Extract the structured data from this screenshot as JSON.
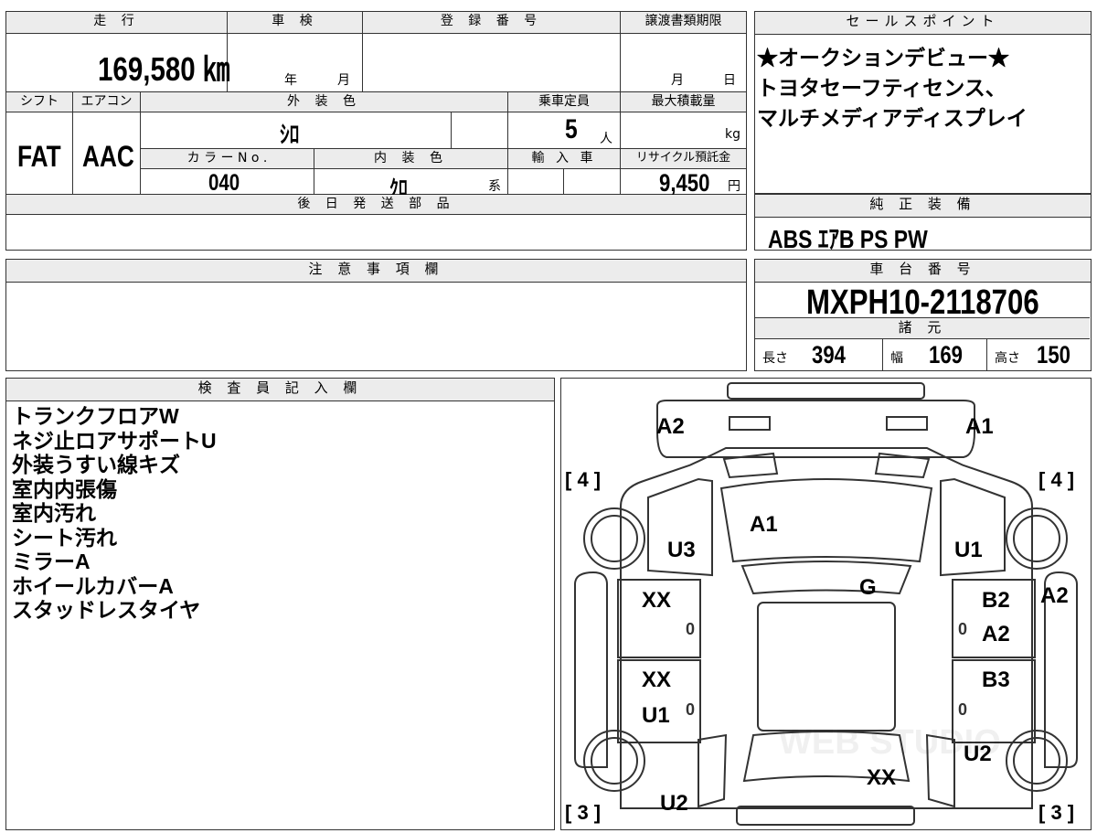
{
  "top_info": {
    "mileage_label": "走 行",
    "mileage_value": "169,580 ㎞",
    "inspection_label": "車 検",
    "inspection_year": "年",
    "inspection_month": "月",
    "registration_label": "登 録 番 号",
    "transfer_label": "譲渡書類期限",
    "transfer_month": "月",
    "transfer_day": "日",
    "shift_label": "シフト",
    "shift_value": "FAT",
    "ac_label": "エアコン",
    "ac_value": "AAC",
    "exterior_color_label": "外 装 色",
    "exterior_color_value": "ｼﾛ",
    "capacity_label": "乗車定員",
    "capacity_value": "5",
    "capacity_unit": "人",
    "max_load_label": "最大積載量",
    "max_load_unit": "kg",
    "color_no_label": "カ ラ ー N o .",
    "color_no_value": "040",
    "interior_color_label": "内 装 色",
    "interior_color_value": "ｸﾛ",
    "interior_color_suffix": "系",
    "import_label": "輸 入 車",
    "recycle_label": "リサイクル預託金",
    "recycle_value": "9,450",
    "recycle_unit": "円",
    "later_parts_label": "後 日 発 送 部 品"
  },
  "sales_points": {
    "label": "セールスポイント",
    "lines": [
      "★オークションデビュー★",
      "トヨタセーフティセンス、",
      "マルチメディアディスプレイ"
    ]
  },
  "equipment": {
    "label": "純 正 装 備",
    "value": "ABS ｴｱB PS PW"
  },
  "caution": {
    "label": "注 意 事 項 欄"
  },
  "chassis": {
    "label": "車 台 番 号",
    "value": "MXPH10-2118706",
    "spec_label": "諸 元",
    "length_label": "長さ",
    "length_value": "394",
    "width_label": "幅",
    "width_value": "169",
    "height_label": "高さ",
    "height_value": "150"
  },
  "inspector": {
    "label": "検 査 員 記 入 欄",
    "notes": [
      "トランクフロアW",
      "ネジ止ロアサポートU",
      "外装うすい線キズ",
      "室内内張傷",
      "室内汚れ",
      "シート汚れ",
      "ミラーA",
      "ホイールカバーA",
      "スタッドレスタイヤ"
    ]
  },
  "damage_map": {
    "marks": [
      "A2",
      "A1",
      "A1",
      "U3",
      "U1",
      "G",
      "XX",
      "B2",
      "A2",
      "A2",
      "XX",
      "U1",
      "B3",
      "U2",
      "XX",
      "U2"
    ],
    "tire_labels": [
      "[ 4 ]",
      "[ 4 ]",
      "[ 3 ]",
      "[ 3 ]"
    ],
    "zeros": [
      "0",
      "0",
      "0",
      "0"
    ],
    "watermark": "WEB STUDIO"
  }
}
